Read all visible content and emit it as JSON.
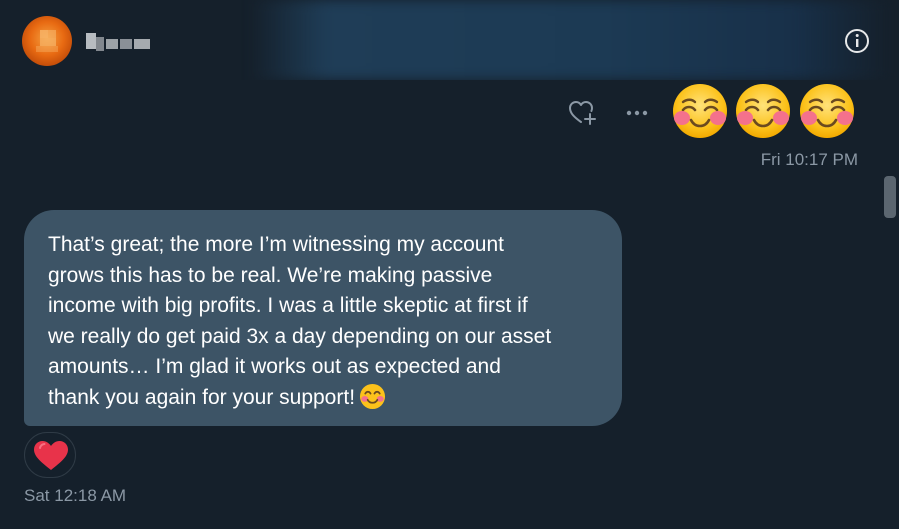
{
  "conversation": {
    "username_obscured": "Qaua",
    "info_icon": "info-circle-icon"
  },
  "messages": {
    "outgoing": {
      "emojis": [
        "smiling-face-with-blush",
        "smiling-face-with-blush",
        "smiling-face-with-blush"
      ],
      "timestamp": "Fri 10:17 PM",
      "actions": [
        "heart-plus-icon",
        "more-horizontal-icon"
      ]
    },
    "incoming": {
      "lines": [
        "That’s great; the more I’m witnessing my account",
        "grows this has to be real. We’re making passive",
        "income with big profits. I was a little skeptic at first if",
        "we really do get paid 3x a day depending on our asset",
        "amounts… I’m glad it works out as expected and",
        "thank you again for your support!"
      ],
      "trailing_emoji": "smiling-face-with-smiling-eyes",
      "reaction": "red-heart",
      "timestamp": "Sat 12:18 AM"
    }
  },
  "colors": {
    "background": "#15202b",
    "bubble": "#3d5466",
    "timestamp": "#8b98a5",
    "heart": "#e8334a"
  }
}
